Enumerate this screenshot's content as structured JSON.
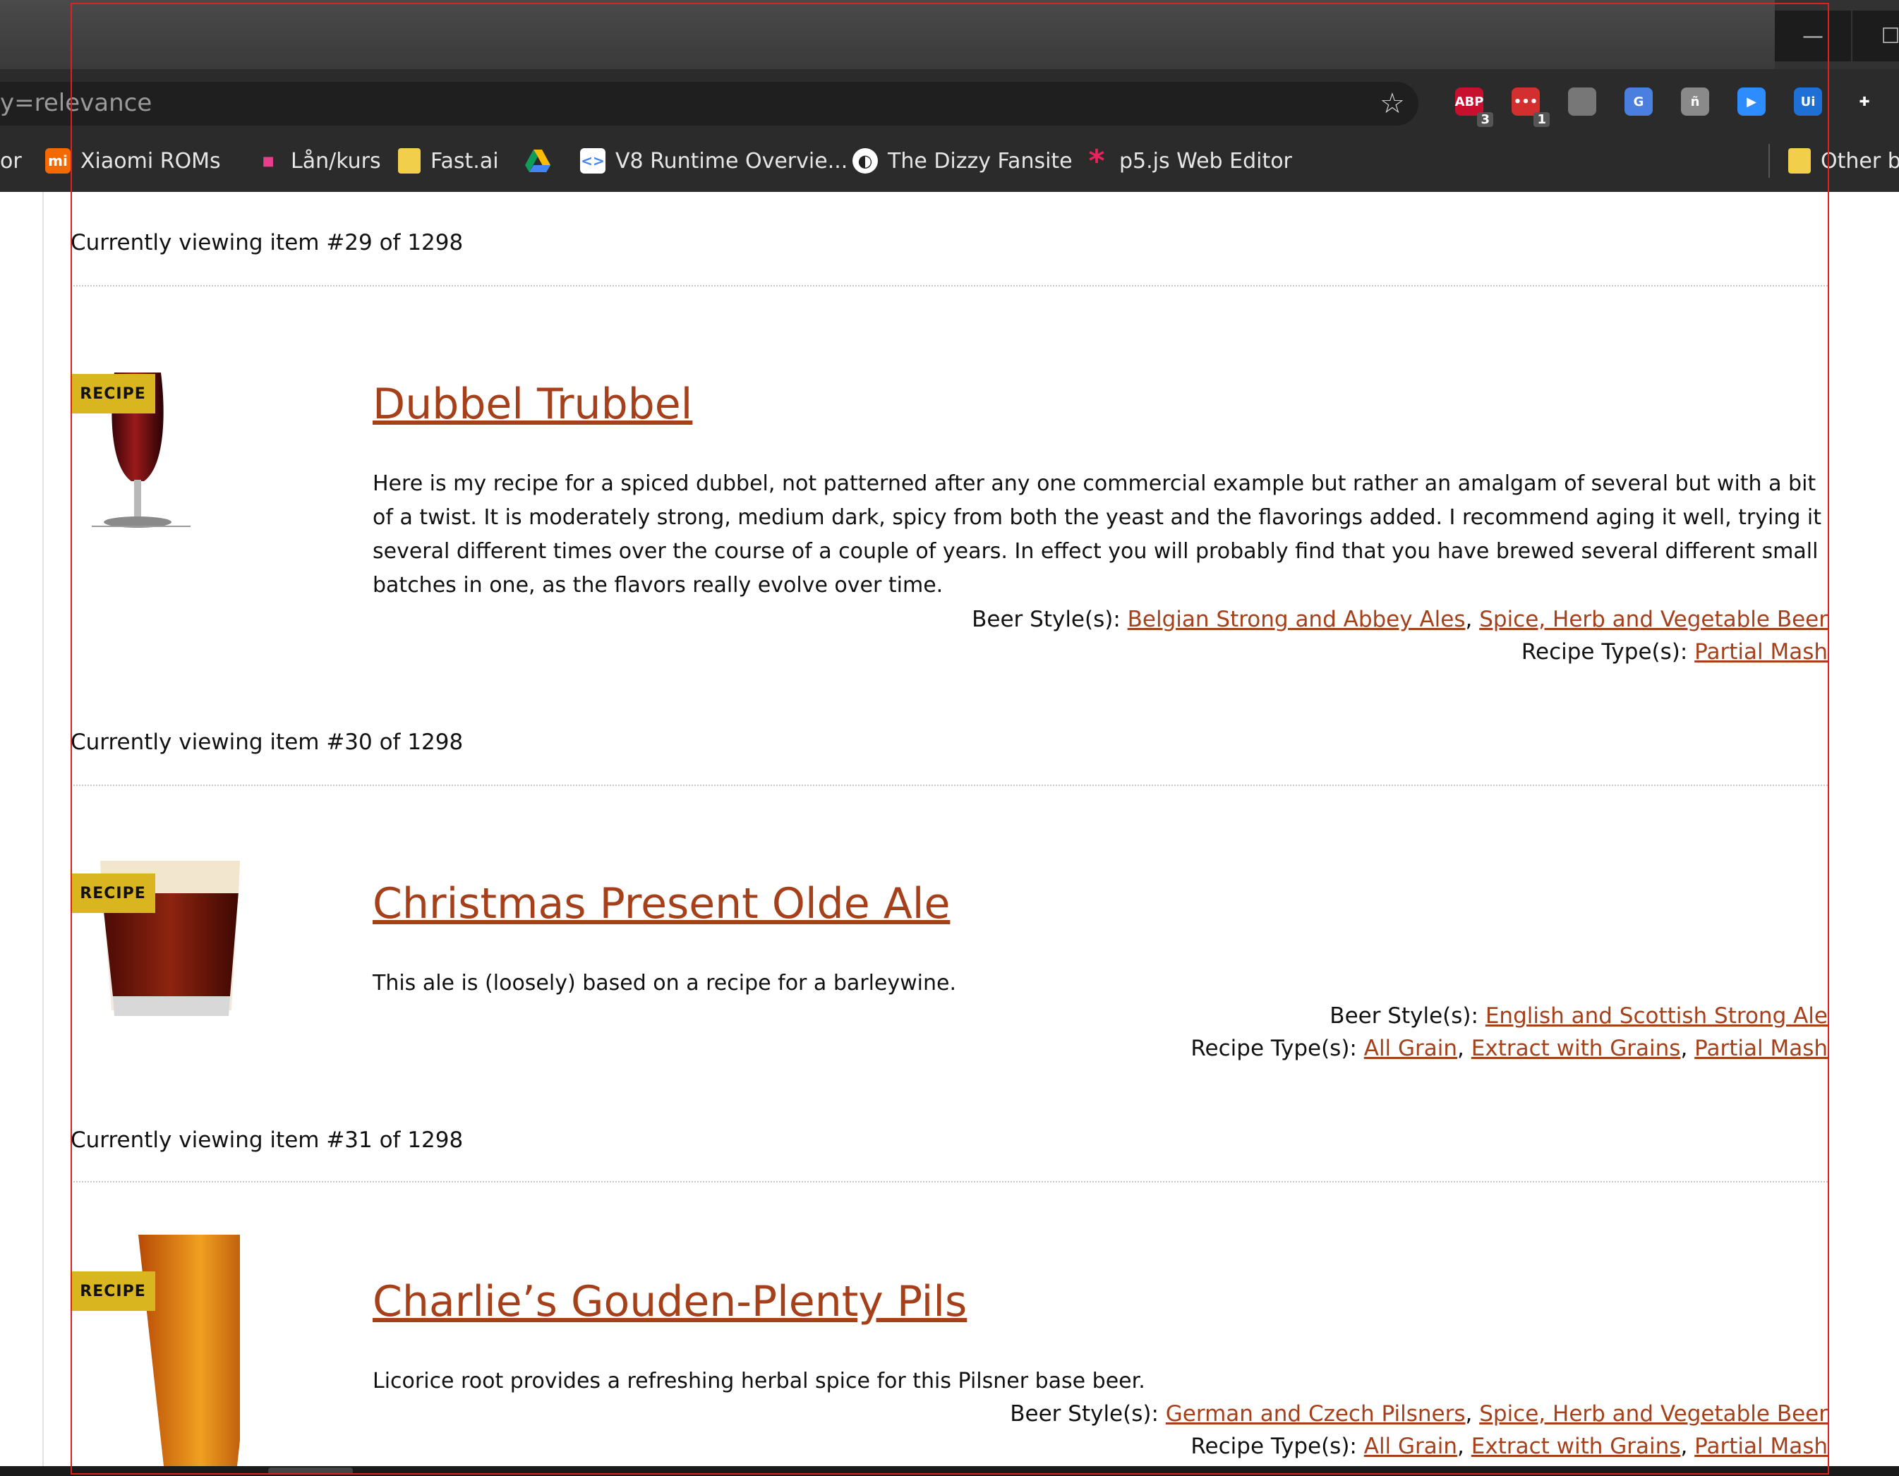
{
  "browser": {
    "url_fragment": "y=relevance",
    "extensions": [
      {
        "name": "adblock-plus-icon",
        "label": "ABP",
        "badge": "3",
        "color": "#c8102e"
      },
      {
        "name": "meetup-icon",
        "label": "•••",
        "badge": "1",
        "color": "#d32f2f"
      },
      {
        "name": "film-reel-icon",
        "label": "",
        "badge": "",
        "color": "#777777"
      },
      {
        "name": "google-translate-icon",
        "label": "G",
        "badge": "",
        "color": "#4a7fe0"
      },
      {
        "name": "hugging-icon",
        "label": "ñ",
        "badge": "",
        "color": "#8a8a8a"
      },
      {
        "name": "zoom-icon",
        "label": "▶",
        "badge": "",
        "color": "#2d8cff"
      },
      {
        "name": "uipath-icon",
        "label": "Ui",
        "badge": "",
        "color": "#1e6fd6"
      },
      {
        "name": "puzzle-icon",
        "label": "✚",
        "badge": "",
        "color": "#2b2b2b"
      }
    ],
    "bookmarks": [
      {
        "label": "or",
        "icon": ""
      },
      {
        "label": "Xiaomi ROMs",
        "icon": "mi"
      },
      {
        "label": "Lån/kurs",
        "icon": "■"
      },
      {
        "label": "Fast.ai",
        "icon": "folder"
      },
      {
        "label": "",
        "icon": "drive"
      },
      {
        "label": "V8 Runtime Overvie...",
        "icon": "<>"
      },
      {
        "label": "The Dizzy Fansite",
        "icon": "globe"
      },
      {
        "label": "p5.js Web Editor",
        "icon": "*"
      },
      {
        "label": "Other b",
        "icon": "folder"
      }
    ]
  },
  "items": [
    {
      "viewing": "Currently viewing item #29 of 1298",
      "badge": "RECIPE",
      "title": "Dubbel Trubbel",
      "description": "Here is my recipe for a spiced dubbel, not patterned after any one commercial example but rather an amalgam of several but with a bit of a twist. It is moderately strong, medium dark, spicy from both the yeast and the flavorings added. I recommend aging it well, trying it several different times over the course of a couple of years. In effect you will probably find that you have brewed several different small batches in one, as the flavors really evolve over time.",
      "styles_label": "Beer Style(s):",
      "styles": [
        "Belgian Strong and Abbey Ales",
        "Spice, Herb and Vegetable Beer"
      ],
      "types_label": "Recipe Type(s):",
      "types": [
        "Partial Mash"
      ]
    },
    {
      "viewing": "Currently viewing item #30 of 1298",
      "badge": "RECIPE",
      "title": "Christmas Present Olde Ale",
      "description": "This ale is (loosely) based on a recipe for a barleywine.",
      "styles_label": "Beer Style(s):",
      "styles": [
        "English and Scottish Strong Ale"
      ],
      "types_label": "Recipe Type(s):",
      "types": [
        "All Grain",
        "Extract with Grains",
        "Partial Mash"
      ]
    },
    {
      "viewing": "Currently viewing item #31 of 1298",
      "badge": "RECIPE",
      "title": "Charlie’s Gouden-Plenty Pils",
      "description": "Licorice root provides a refreshing herbal spice for this Pilsner base beer.",
      "styles_label": "Beer Style(s):",
      "styles": [
        "German and Czech Pilsners",
        "Spice, Herb and Vegetable Beer"
      ],
      "types_label": "Recipe Type(s):",
      "types": [
        "All Grain",
        "Extract with Grains",
        "Partial Mash"
      ]
    }
  ],
  "colors": {
    "link": "#a6401a",
    "badge": "#d9b520"
  }
}
